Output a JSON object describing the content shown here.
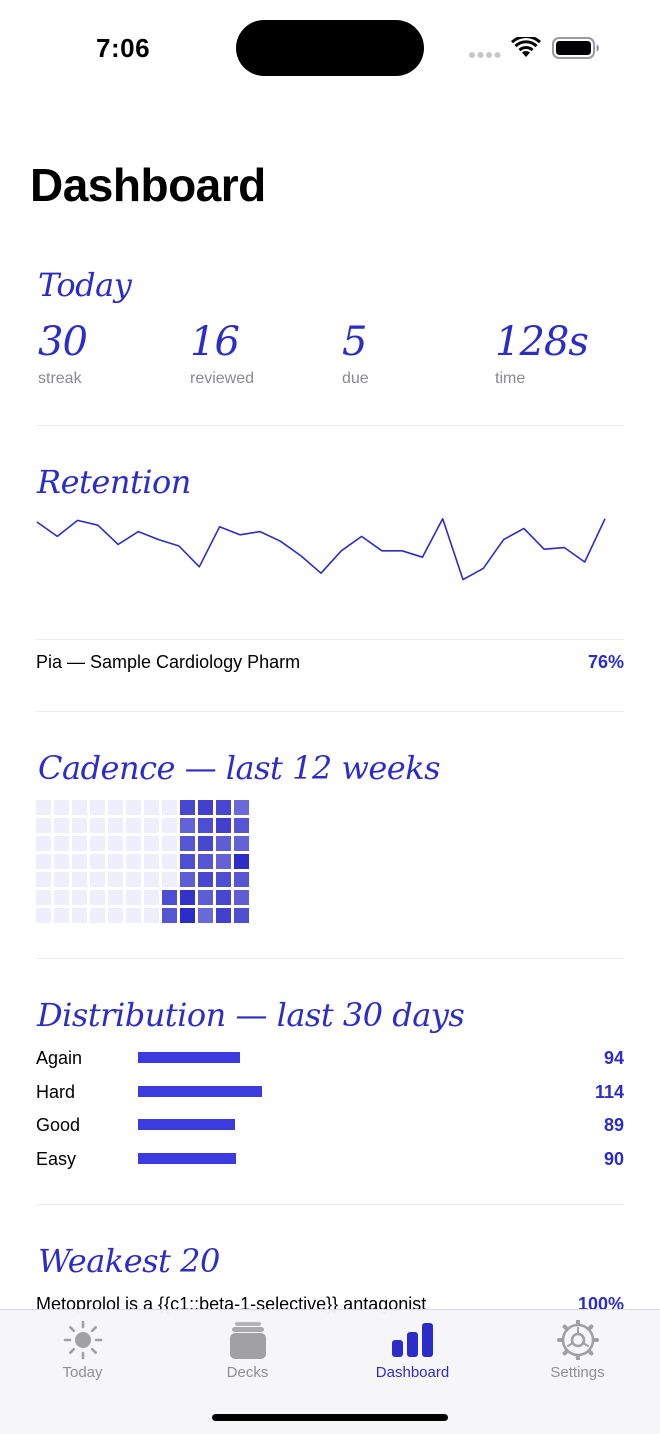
{
  "status": {
    "time": "7:06"
  },
  "page": {
    "title": "Dashboard"
  },
  "today": {
    "heading": "Today",
    "stats": [
      {
        "value": "30",
        "label": "streak"
      },
      {
        "value": "16",
        "label": "reviewed"
      },
      {
        "value": "5",
        "label": "due"
      },
      {
        "value": "128s",
        "label": "time"
      }
    ]
  },
  "retention": {
    "heading": "Retention",
    "deck_name": "Pia — Sample Cardiology Pharm",
    "deck_percent": "76%"
  },
  "chart_data": {
    "type": "line",
    "title": "Retention",
    "series": [
      {
        "values": [
          0.85,
          0.76,
          0.86,
          0.83,
          0.71,
          0.79,
          0.74,
          0.7,
          0.57,
          0.82,
          0.77,
          0.79,
          0.73,
          0.64,
          0.53,
          0.67,
          0.76,
          0.67,
          0.67,
          0.63,
          0.87,
          0.49,
          0.56,
          0.74,
          0.81,
          0.68,
          0.69,
          0.6,
          0.87
        ]
      }
    ],
    "grid": false,
    "legend": "none"
  },
  "cadence": {
    "heading": "Cadence — last 12 weeks",
    "weeks": [
      [
        0.05,
        0.05,
        0.05,
        0.05,
        0.05,
        0.05,
        0.05
      ],
      [
        0.05,
        0.05,
        0.05,
        0.05,
        0.05,
        0.05,
        0.05
      ],
      [
        0.05,
        0.05,
        0.05,
        0.05,
        0.05,
        0.05,
        0.05
      ],
      [
        0.05,
        0.05,
        0.05,
        0.05,
        0.05,
        0.05,
        0.05
      ],
      [
        0.05,
        0.05,
        0.05,
        0.05,
        0.05,
        0.05,
        0.05
      ],
      [
        0.05,
        0.05,
        0.05,
        0.05,
        0.05,
        0.05,
        0.05
      ],
      [
        0.05,
        0.05,
        0.05,
        0.05,
        0.05,
        0.05,
        0.05
      ],
      [
        0.05,
        0.05,
        0.05,
        0.05,
        0.05,
        0.75,
        0.7
      ],
      [
        0.8,
        0.6,
        0.7,
        0.75,
        0.65,
        0.95,
        1.0
      ],
      [
        0.85,
        0.75,
        0.8,
        0.7,
        0.8,
        0.65,
        0.55
      ],
      [
        0.8,
        0.85,
        0.65,
        0.6,
        0.75,
        0.8,
        0.85
      ],
      [
        0.55,
        0.7,
        0.6,
        1.0,
        0.7,
        0.65,
        0.75
      ]
    ]
  },
  "distribution": {
    "heading": "Distribution — last 30 days",
    "rows": [
      {
        "label": "Again",
        "count": "94",
        "value": 94
      },
      {
        "label": "Hard",
        "count": "114",
        "value": 114
      },
      {
        "label": "Good",
        "count": "89",
        "value": 89
      },
      {
        "label": "Easy",
        "count": "90",
        "value": 90
      }
    ]
  },
  "weakest": {
    "heading": "Weakest 20",
    "first_text": "Metoprolol is a {{c1::beta-1-selective}} antagonist",
    "first_percent": "100%"
  },
  "tabs": [
    {
      "label": "Today",
      "icon": "sun-icon"
    },
    {
      "label": "Decks",
      "icon": "decks-icon"
    },
    {
      "label": "Dashboard",
      "icon": "bar-chart-icon"
    },
    {
      "label": "Settings",
      "icon": "gear-icon"
    }
  ],
  "colors": {
    "accent": "#2c2cc9",
    "bar": "#3b3be0"
  }
}
